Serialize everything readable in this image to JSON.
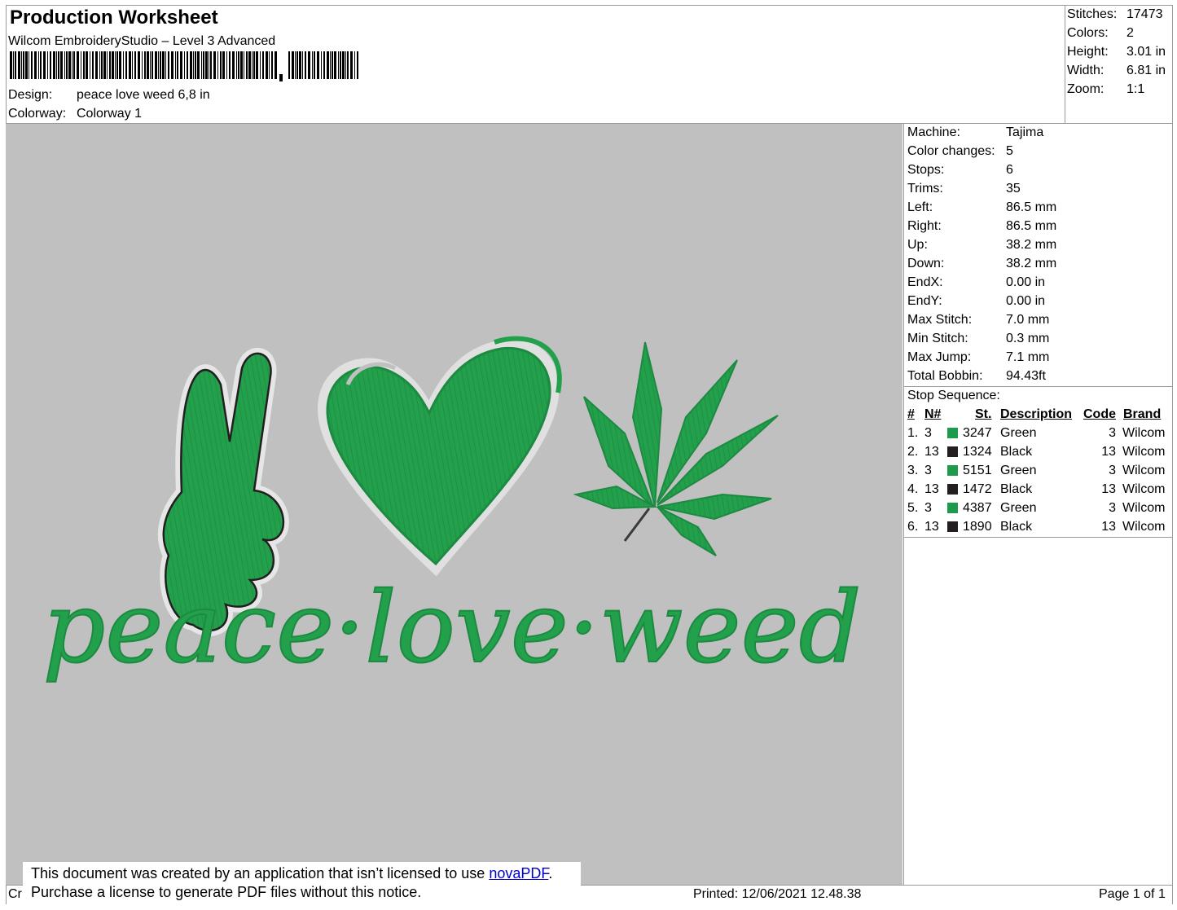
{
  "header": {
    "title": "Production Worksheet",
    "software": "Wilcom EmbroideryStudio – Level 3 Advanced",
    "design_label": "Design:",
    "design_value": "peace love weed 6,8 in",
    "colorway_label": "Colorway:",
    "colorway_value": "Colorway 1"
  },
  "top_stats": [
    {
      "label": "Stitches:",
      "value": "17473"
    },
    {
      "label": "Colors:",
      "value": "2"
    },
    {
      "label": "Height:",
      "value": "3.01 in"
    },
    {
      "label": "Width:",
      "value": "6.81 in"
    },
    {
      "label": "Zoom:",
      "value": "1:1"
    }
  ],
  "machine_stats": [
    {
      "label": "Machine:",
      "value": "Tajima"
    },
    {
      "label": "Color changes:",
      "value": "5"
    },
    {
      "label": "Stops:",
      "value": "6"
    },
    {
      "label": "Trims:",
      "value": "35"
    },
    {
      "label": "Left:",
      "value": "86.5 mm"
    },
    {
      "label": "Right:",
      "value": "86.5 mm"
    },
    {
      "label": "Up:",
      "value": "38.2 mm"
    },
    {
      "label": "Down:",
      "value": "38.2 mm"
    },
    {
      "label": "EndX:",
      "value": "0.00 in"
    },
    {
      "label": "EndY:",
      "value": "0.00 in"
    },
    {
      "label": "Max Stitch:",
      "value": "7.0 mm"
    },
    {
      "label": "Min Stitch:",
      "value": "0.3 mm"
    },
    {
      "label": "Max Jump:",
      "value": "7.1 mm"
    },
    {
      "label": "Total Bobbin:",
      "value": "94.43ft"
    }
  ],
  "stop_sequence": {
    "title": "Stop Sequence:",
    "headers": {
      "num": "#",
      "n": "N#",
      "st": "St.",
      "description": "Description",
      "code": "Code",
      "brand": "Brand"
    },
    "rows": [
      {
        "idx": "1.",
        "n": "3",
        "color": "#1e9a4c",
        "st": "3247",
        "description": "Green",
        "code": "3",
        "brand": "Wilcom"
      },
      {
        "idx": "2.",
        "n": "13",
        "color": "#231f20",
        "st": "1324",
        "description": "Black",
        "code": "13",
        "brand": "Wilcom"
      },
      {
        "idx": "3.",
        "n": "3",
        "color": "#1e9a4c",
        "st": "5151",
        "description": "Green",
        "code": "3",
        "brand": "Wilcom"
      },
      {
        "idx": "4.",
        "n": "13",
        "color": "#231f20",
        "st": "1472",
        "description": "Black",
        "code": "13",
        "brand": "Wilcom"
      },
      {
        "idx": "5.",
        "n": "3",
        "color": "#1e9a4c",
        "st": "4387",
        "description": "Green",
        "code": "3",
        "brand": "Wilcom"
      },
      {
        "idx": "6.",
        "n": "13",
        "color": "#231f20",
        "st": "1890",
        "description": "Black",
        "code": "13",
        "brand": "Wilcom"
      }
    ]
  },
  "design_preview": {
    "text": "peace·love·weed",
    "thread_green": "#23a04c",
    "thread_black": "#231f20",
    "background": "#c0c0c0"
  },
  "notice": {
    "line1_prefix": "This document was created by an application that isn’t licensed to use ",
    "link": "novaPDF",
    "line1_suffix": ".",
    "line2": "Purchase a license to generate PDF files without this notice."
  },
  "footer": {
    "created_truncated": "Cr",
    "printed": "Printed: 12/06/2021 12.48.38",
    "page": "Page 1 of 1"
  }
}
